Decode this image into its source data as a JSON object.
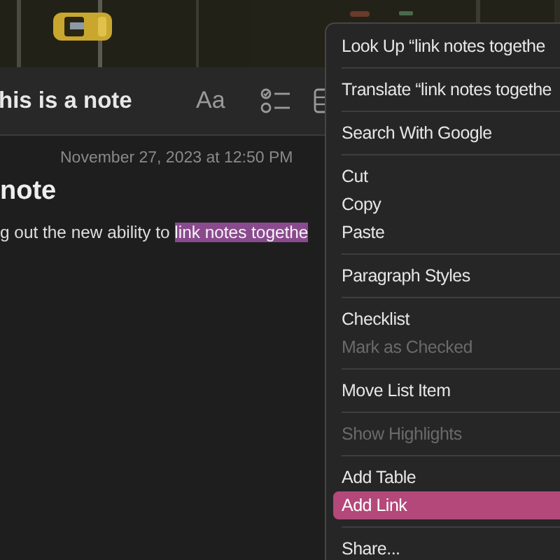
{
  "note": {
    "title": "his is a note",
    "format_button": "Aa",
    "date": "November 27, 2023 at 12:50 PM",
    "heading": "note",
    "body": "g out the new ability to ",
    "selection": "link notes togethe"
  },
  "menu": [
    {
      "kind": "item",
      "label": "Look Up “link notes togethe",
      "disabled": false,
      "selected": false
    },
    {
      "kind": "separator"
    },
    {
      "kind": "item",
      "label": "Translate “link notes togethe",
      "disabled": false,
      "selected": false
    },
    {
      "kind": "separator"
    },
    {
      "kind": "item",
      "label": "Search With Google",
      "disabled": false,
      "selected": false
    },
    {
      "kind": "separator"
    },
    {
      "kind": "item",
      "label": "Cut",
      "disabled": false,
      "selected": false
    },
    {
      "kind": "item",
      "label": "Copy",
      "disabled": false,
      "selected": false
    },
    {
      "kind": "item",
      "label": "Paste",
      "disabled": false,
      "selected": false
    },
    {
      "kind": "separator"
    },
    {
      "kind": "item",
      "label": "Paragraph Styles",
      "disabled": false,
      "selected": false
    },
    {
      "kind": "separator"
    },
    {
      "kind": "item",
      "label": "Checklist",
      "disabled": false,
      "selected": false
    },
    {
      "kind": "item",
      "label": "Mark as Checked",
      "disabled": true,
      "selected": false
    },
    {
      "kind": "separator"
    },
    {
      "kind": "item",
      "label": "Move List Item",
      "disabled": false,
      "selected": false
    },
    {
      "kind": "separator"
    },
    {
      "kind": "item",
      "label": "Show Highlights",
      "disabled": true,
      "selected": false
    },
    {
      "kind": "separator"
    },
    {
      "kind": "item",
      "label": "Add Table",
      "disabled": false,
      "selected": false
    },
    {
      "kind": "item",
      "label": "Add Link",
      "disabled": false,
      "selected": true
    },
    {
      "kind": "separator"
    },
    {
      "kind": "item",
      "label": "Share...",
      "disabled": false,
      "selected": false
    }
  ]
}
